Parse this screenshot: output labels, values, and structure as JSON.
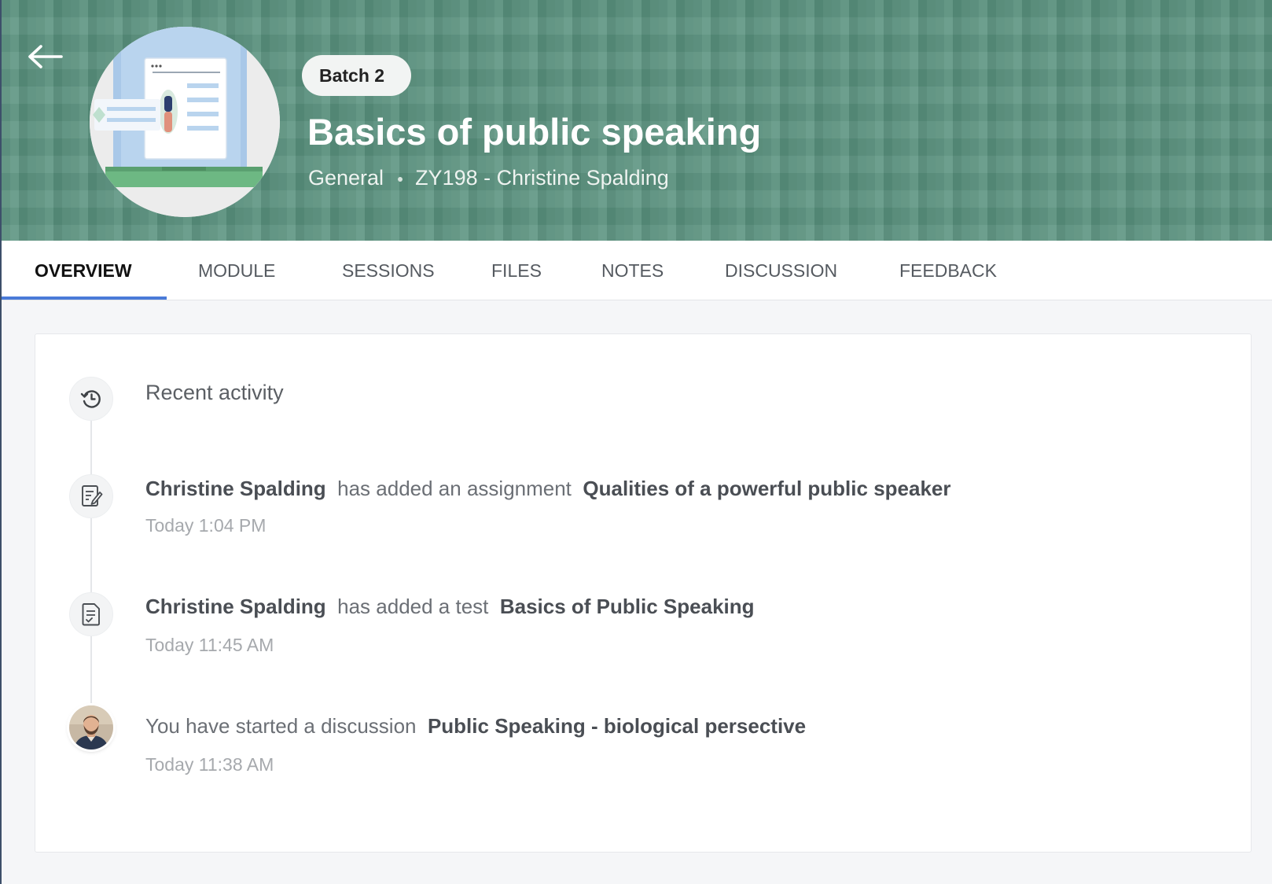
{
  "header": {
    "batch": "Batch 2",
    "title": "Basics of public speaking",
    "category": "General",
    "instructor": "ZY198 - Christine Spalding"
  },
  "tabs": [
    {
      "label": "OVERVIEW",
      "active": true
    },
    {
      "label": "MODULE"
    },
    {
      "label": "SESSIONS"
    },
    {
      "label": "FILES"
    },
    {
      "label": "NOTES"
    },
    {
      "label": "DISCUSSION"
    },
    {
      "label": "FEEDBACK"
    }
  ],
  "activity": {
    "title": "Recent activity",
    "items": [
      {
        "actor": "Christine Spalding",
        "action": "has added an assignment",
        "subject": "Qualities of a powerful public speaker",
        "time": "Today 1:04 PM",
        "icon": "assignment-icon"
      },
      {
        "actor": "Christine Spalding",
        "action": "has added a test",
        "subject": "Basics of Public Speaking",
        "time": "Today 11:45 AM",
        "icon": "test-icon"
      },
      {
        "actor": "",
        "action": "You have started a discussion",
        "subject": "Public Speaking - biological persective",
        "time": "Today 11:38 AM",
        "icon": "user-avatar"
      }
    ]
  },
  "colors": {
    "banner": "#5b9480",
    "tab_active_underline": "#4a7bd8"
  }
}
